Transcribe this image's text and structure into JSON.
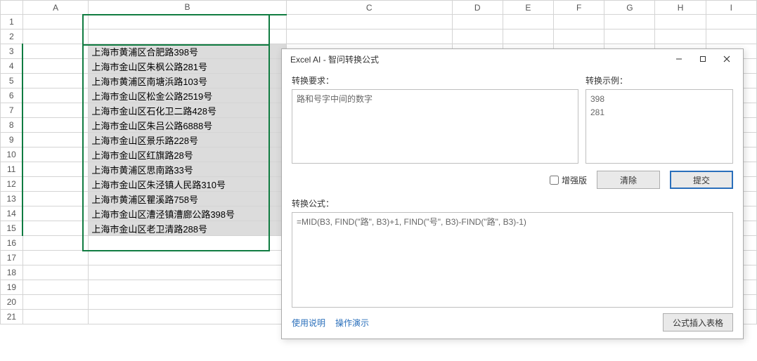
{
  "columns": [
    "A",
    "B",
    "C",
    "D",
    "E",
    "F",
    "G",
    "H",
    "I"
  ],
  "rows": [
    "1",
    "2",
    "3",
    "4",
    "5",
    "6",
    "7",
    "8",
    "9",
    "10",
    "11",
    "12",
    "13",
    "14",
    "15",
    "16",
    "17",
    "18",
    "19",
    "20",
    "21"
  ],
  "cells": {
    "B3": "上海市黄浦区合肥路398号",
    "B4": "上海市金山区朱枫公路281号",
    "B5": "上海市黄浦区南塘浜路103号",
    "B6": "上海市金山区松金公路2519号",
    "B7": "上海市金山区石化卫二路428号",
    "B8": "上海市金山区朱吕公路6888号",
    "B9": "上海市金山区景乐路228号",
    "B10": "上海市金山区红旗路28号",
    "B11": "上海市黄浦区思南路33号",
    "B12": "上海市金山区朱泾镇人民路310号",
    "B13": "上海市黄浦区瞿溪路758号",
    "B14": "上海市金山区漕泾镇漕廊公路398号",
    "B15": "上海市金山区老卫清路288号"
  },
  "dialog": {
    "title": "Excel AI - 智问转换公式",
    "req_label": "转换要求：",
    "req_text": "路和号字中间的数字",
    "ex_label": "转换示例：",
    "ex_text": "398\n281",
    "enhanced": "增强版",
    "clear": "清除",
    "submit": "提交",
    "formula_label": "转换公式：",
    "formula_text": "=MID(B3, FIND(\"路\", B3)+1, FIND(\"号\", B3)-FIND(\"路\", B3)-1)",
    "link_help": "使用说明",
    "link_demo": "操作演示",
    "insert": "公式插入表格"
  }
}
